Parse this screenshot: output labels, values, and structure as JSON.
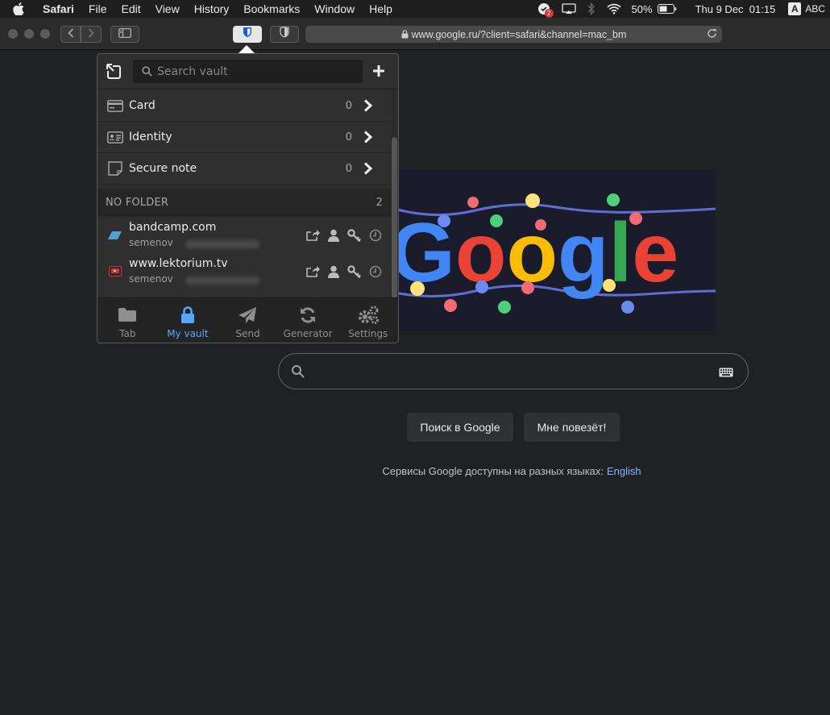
{
  "menubar": {
    "app": "Safari",
    "items": [
      "File",
      "Edit",
      "View",
      "History",
      "Bookmarks",
      "Window",
      "Help"
    ],
    "badge_count": "2",
    "battery": "50%",
    "datetime": "Thu 9 Dec  01:15",
    "input_source_letter": "A",
    "input_source": "ABC"
  },
  "toolbar": {
    "url": "www.google.ru/?client=safari&channel=mac_bm"
  },
  "bitwarden": {
    "search_placeholder": "Search vault",
    "types": [
      {
        "label": "Card",
        "count": "0",
        "icon": "card-icon"
      },
      {
        "label": "Identity",
        "count": "0",
        "icon": "identity-icon"
      },
      {
        "label": "Secure note",
        "count": "0",
        "icon": "note-icon"
      }
    ],
    "folder_heading": "NO FOLDER",
    "folder_count": "2",
    "logins": [
      {
        "name": "bandcamp.com",
        "username": "semenov"
      },
      {
        "name": "www.lektorium.tv",
        "username": "semenov"
      }
    ],
    "tabs": [
      {
        "label": "Tab",
        "icon": "folder-icon"
      },
      {
        "label": "My vault",
        "icon": "lock-icon"
      },
      {
        "label": "Send",
        "icon": "paper-plane-icon"
      },
      {
        "label": "Generator",
        "icon": "refresh-icon"
      },
      {
        "label": "Settings",
        "icon": "gears-icon"
      }
    ],
    "active_tab": "My vault",
    "accent_color": "#55a8ff"
  },
  "google": {
    "doodle_text": "Google",
    "search_button": "Поиск в Google",
    "lucky_button": "Мне повезёт!",
    "lang_text": "Сервисы Google доступны на разных языках:",
    "lang_link": "English"
  }
}
